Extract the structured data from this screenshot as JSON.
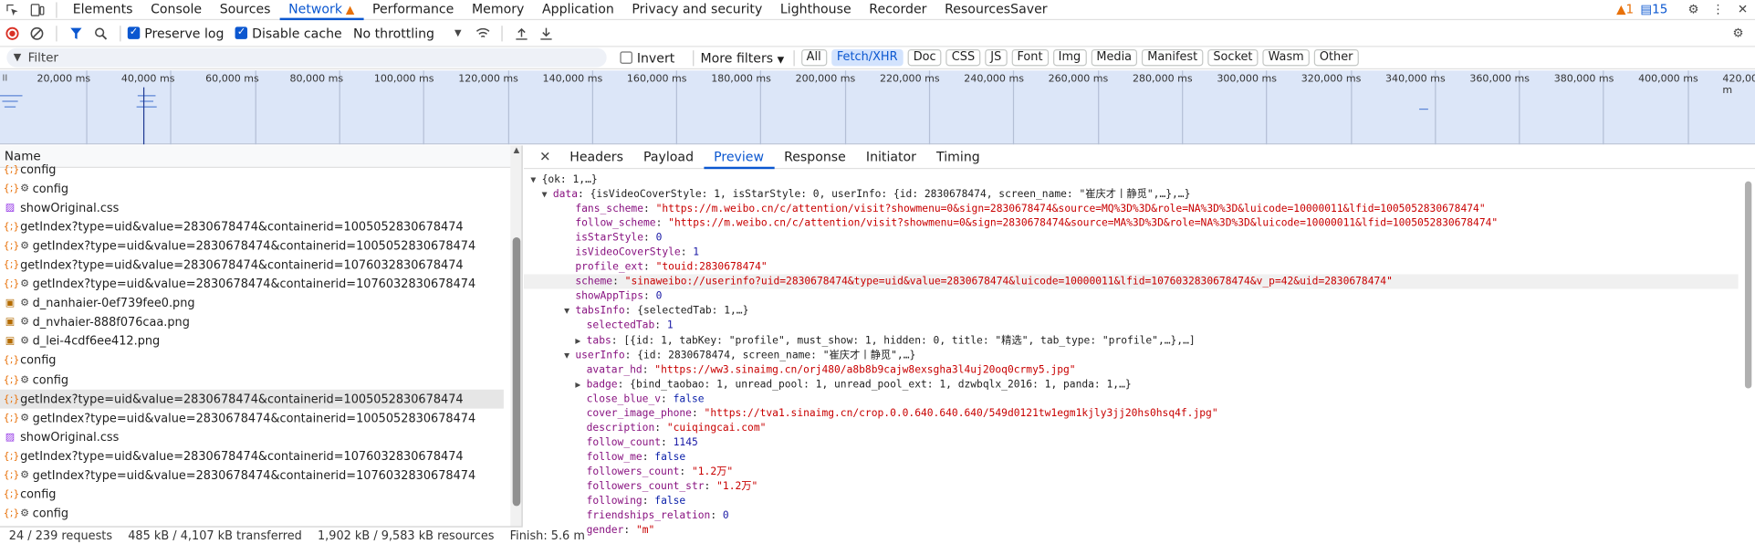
{
  "topbar": {
    "tabs": [
      "Elements",
      "Console",
      "Sources",
      "Network",
      "Performance",
      "Memory",
      "Application",
      "Privacy and security",
      "Lighthouse",
      "Recorder",
      "ResourcesSaver"
    ],
    "active_index": 3,
    "warn_count": "1",
    "info_count": "15"
  },
  "toolbar": {
    "preserve_log": "Preserve log",
    "disable_cache": "Disable cache",
    "throttling": "No throttling"
  },
  "filter": {
    "placeholder": "Filter",
    "invert": "Invert",
    "more_filters": "More filters",
    "types": [
      "All",
      "Fetch/XHR",
      "Doc",
      "CSS",
      "JS",
      "Font",
      "Img",
      "Media",
      "Manifest",
      "Socket",
      "Wasm",
      "Other"
    ],
    "active_type": "Fetch/XHR"
  },
  "overview": {
    "ticks": [
      "20,000 ms",
      "40,000 ms",
      "60,000 ms",
      "80,000 ms",
      "100,000 ms",
      "120,000 ms",
      "140,000 ms",
      "160,000 ms",
      "180,000 ms",
      "200,000 ms",
      "220,000 ms",
      "240,000 ms",
      "260,000 ms",
      "280,000 ms",
      "300,000 ms",
      "320,000 ms",
      "340,000 ms",
      "360,000 ms",
      "380,000 ms",
      "400,000 ms",
      "420,000 m"
    ]
  },
  "list": {
    "header": "Name",
    "requests": [
      {
        "icon": "xhr",
        "gear": false,
        "name": "config"
      },
      {
        "icon": "xhr",
        "gear": true,
        "name": "config"
      },
      {
        "icon": "css",
        "gear": false,
        "name": "showOriginal.css"
      },
      {
        "icon": "xhr",
        "gear": false,
        "name": "getIndex?type=uid&value=2830678474&containerid=1005052830678474"
      },
      {
        "icon": "xhr",
        "gear": true,
        "name": "getIndex?type=uid&value=2830678474&containerid=1005052830678474"
      },
      {
        "icon": "xhr",
        "gear": false,
        "name": "getIndex?type=uid&value=2830678474&containerid=1076032830678474"
      },
      {
        "icon": "xhr",
        "gear": true,
        "name": "getIndex?type=uid&value=2830678474&containerid=1076032830678474"
      },
      {
        "icon": "img",
        "gear": true,
        "name": "d_nanhaier-0ef739fee0.png"
      },
      {
        "icon": "img",
        "gear": true,
        "name": "d_nvhaier-888f076caa.png"
      },
      {
        "icon": "img",
        "gear": true,
        "name": "d_lei-4cdf6ee412.png"
      },
      {
        "icon": "xhr",
        "gear": false,
        "name": "config"
      },
      {
        "icon": "xhr",
        "gear": true,
        "name": "config"
      },
      {
        "icon": "xhr",
        "gear": false,
        "name": "getIndex?type=uid&value=2830678474&containerid=1005052830678474",
        "selected": true
      },
      {
        "icon": "xhr",
        "gear": true,
        "name": "getIndex?type=uid&value=2830678474&containerid=1005052830678474"
      },
      {
        "icon": "css",
        "gear": false,
        "name": "showOriginal.css"
      },
      {
        "icon": "xhr",
        "gear": false,
        "name": "getIndex?type=uid&value=2830678474&containerid=1076032830678474"
      },
      {
        "icon": "xhr",
        "gear": true,
        "name": "getIndex?type=uid&value=2830678474&containerid=1076032830678474"
      },
      {
        "icon": "xhr",
        "gear": false,
        "name": "config"
      },
      {
        "icon": "xhr",
        "gear": true,
        "name": "config"
      }
    ]
  },
  "status": {
    "requests": "24 / 239 requests",
    "transferred": "485 kB / 4,107 kB transferred",
    "resources": "1,902 kB / 9,583 kB resources",
    "finish": "Finish: 5.6 m"
  },
  "detail": {
    "tabs": [
      "Headers",
      "Payload",
      "Preview",
      "Response",
      "Initiator",
      "Timing"
    ],
    "active_index": 2
  },
  "preview": [
    {
      "i": 0,
      "t": "down",
      "k": "",
      "v": "{ok: 1,…}",
      "vt": "p"
    },
    {
      "i": 1,
      "t": "down",
      "k": "data",
      "v": "{isVideoCoverStyle: 1, isStarStyle: 0, userInfo: {id: 2830678474, screen_name: \"崔庆才丨静觅\",…},…}",
      "vt": "p"
    },
    {
      "i": 2,
      "t": "",
      "k": "fans_scheme",
      "v": "\"https://m.weibo.cn/c/attention/visit?showmenu=0&sign=2830678474&source=MQ%3D%3D&role=NA%3D%3D&luicode=10000011&lfid=1005052830678474\"",
      "vt": "s"
    },
    {
      "i": 2,
      "t": "",
      "k": "follow_scheme",
      "v": "\"https://m.weibo.cn/c/attention/visit?showmenu=0&sign=2830678474&source=MA%3D%3D&role=NA%3D%3D&luicode=10000011&lfid=1005052830678474\"",
      "vt": "s"
    },
    {
      "i": 2,
      "t": "",
      "k": "isStarStyle",
      "v": "0",
      "vt": "n"
    },
    {
      "i": 2,
      "t": "",
      "k": "isVideoCoverStyle",
      "v": "1",
      "vt": "n"
    },
    {
      "i": 2,
      "t": "",
      "k": "profile_ext",
      "v": "\"touid:2830678474\"",
      "vt": "s"
    },
    {
      "i": 2,
      "t": "",
      "k": "scheme",
      "v": "\"sinaweibo://userinfo?uid=2830678474&type=uid&value=2830678474&luicode=10000011&lfid=1076032830678474&v_p=42&uid=2830678474\"",
      "vt": "s",
      "hl": true
    },
    {
      "i": 2,
      "t": "",
      "k": "showAppTips",
      "v": "0",
      "vt": "n"
    },
    {
      "i": 2,
      "t": "down",
      "k": "tabsInfo",
      "v": "{selectedTab: 1,…}",
      "vt": "p"
    },
    {
      "i": 3,
      "t": "",
      "k": "selectedTab",
      "v": "1",
      "vt": "n"
    },
    {
      "i": 3,
      "t": "right",
      "k": "tabs",
      "v": "[{id: 1, tabKey: \"profile\", must_show: 1, hidden: 0, title: \"精选\", tab_type: \"profile\",…},…]",
      "vt": "p"
    },
    {
      "i": 2,
      "t": "down",
      "k": "userInfo",
      "v": "{id: 2830678474, screen_name: \"崔庆才丨静觅\",…}",
      "vt": "p"
    },
    {
      "i": 3,
      "t": "",
      "k": "avatar_hd",
      "v": "\"https://ww3.sinaimg.cn/orj480/a8b8b9cajw8exsgha3l4uj20oq0crmy5.jpg\"",
      "vt": "s"
    },
    {
      "i": 3,
      "t": "right",
      "k": "badge",
      "v": "{bind_taobao: 1, unread_pool: 1, unread_pool_ext: 1, dzwbqlx_2016: 1, panda: 1,…}",
      "vt": "p"
    },
    {
      "i": 3,
      "t": "",
      "k": "close_blue_v",
      "v": "false",
      "vt": "b"
    },
    {
      "i": 3,
      "t": "",
      "k": "cover_image_phone",
      "v": "\"https://tva1.sinaimg.cn/crop.0.0.640.640.640/549d0121tw1egm1kjly3jj20hs0hsq4f.jpg\"",
      "vt": "s"
    },
    {
      "i": 3,
      "t": "",
      "k": "description",
      "v": "\"cuiqingcai.com\"",
      "vt": "s"
    },
    {
      "i": 3,
      "t": "",
      "k": "follow_count",
      "v": "1145",
      "vt": "n"
    },
    {
      "i": 3,
      "t": "",
      "k": "follow_me",
      "v": "false",
      "vt": "b"
    },
    {
      "i": 3,
      "t": "",
      "k": "followers_count",
      "v": "\"1.2万\"",
      "vt": "s"
    },
    {
      "i": 3,
      "t": "",
      "k": "followers_count_str",
      "v": "\"1.2万\"",
      "vt": "s"
    },
    {
      "i": 3,
      "t": "",
      "k": "following",
      "v": "false",
      "vt": "b"
    },
    {
      "i": 3,
      "t": "",
      "k": "friendships_relation",
      "v": "0",
      "vt": "n"
    },
    {
      "i": 3,
      "t": "",
      "k": "gender",
      "v": "\"m\"",
      "vt": "s"
    }
  ]
}
